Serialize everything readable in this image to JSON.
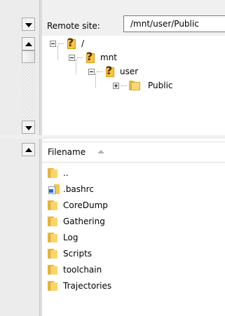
{
  "remote_site": {
    "label": "Remote site:",
    "path": "/mnt/user/Public"
  },
  "tree": {
    "nodes": [
      {
        "label": "/"
      },
      {
        "label": "mnt"
      },
      {
        "label": "user"
      },
      {
        "label": "Public"
      }
    ]
  },
  "file_list": {
    "column_header": "Filename",
    "files": [
      {
        "name": "..",
        "icon": "folder-icon"
      },
      {
        "name": ".bashrc",
        "icon": "file-icon"
      },
      {
        "name": "CoreDump",
        "icon": "folder-icon"
      },
      {
        "name": "Gathering",
        "icon": "folder-icon"
      },
      {
        "name": "Log",
        "icon": "folder-icon"
      },
      {
        "name": "Scripts",
        "icon": "folder-icon"
      },
      {
        "name": "toolchain",
        "icon": "folder-icon"
      },
      {
        "name": "Trajectories",
        "icon": "folder-icon"
      }
    ]
  },
  "colors": {
    "folder": "#f9d878",
    "unknown_folder": "#f6c342",
    "background": "#f0f0f0"
  }
}
